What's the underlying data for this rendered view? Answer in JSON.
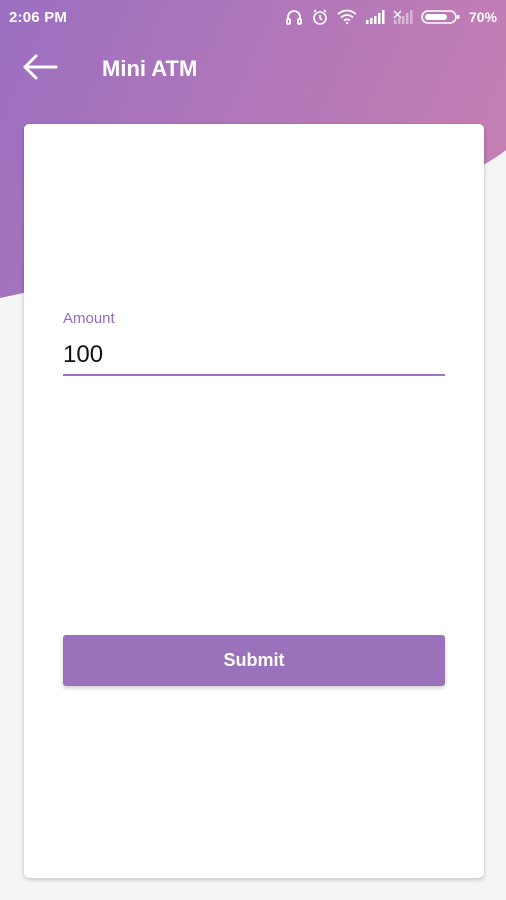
{
  "status_bar": {
    "time": "2:06 PM",
    "battery": "70%",
    "icons": [
      "headphones-icon",
      "alarm-icon",
      "wifi-icon",
      "signal-icon",
      "signal-off-icon",
      "battery-icon"
    ]
  },
  "toolbar": {
    "title": "Mini ATM",
    "back_icon": "arrow-left-icon"
  },
  "form": {
    "amount_label": "Amount",
    "amount_value": "100",
    "submit_label": "Submit"
  },
  "colors": {
    "accent": "#9a72bc",
    "gradient_start": "#9b6fc0",
    "gradient_end": "#c37eb4",
    "background": "#f5f5f5"
  }
}
